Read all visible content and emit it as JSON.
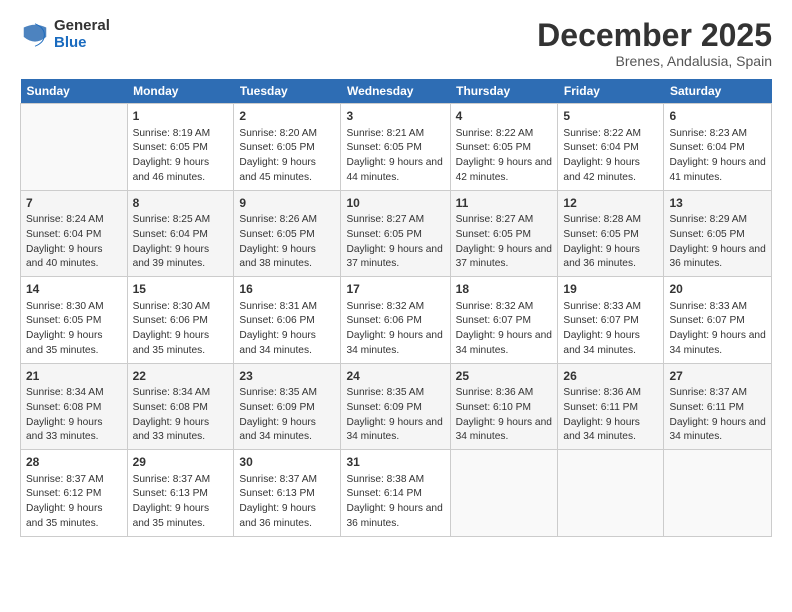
{
  "logo": {
    "general": "General",
    "blue": "Blue"
  },
  "title": "December 2025",
  "location": "Brenes, Andalusia, Spain",
  "headers": [
    "Sunday",
    "Monday",
    "Tuesday",
    "Wednesday",
    "Thursday",
    "Friday",
    "Saturday"
  ],
  "weeks": [
    [
      {
        "day": "",
        "empty": true
      },
      {
        "day": "1",
        "sunrise": "Sunrise: 8:19 AM",
        "sunset": "Sunset: 6:05 PM",
        "daylight": "Daylight: 9 hours and 46 minutes."
      },
      {
        "day": "2",
        "sunrise": "Sunrise: 8:20 AM",
        "sunset": "Sunset: 6:05 PM",
        "daylight": "Daylight: 9 hours and 45 minutes."
      },
      {
        "day": "3",
        "sunrise": "Sunrise: 8:21 AM",
        "sunset": "Sunset: 6:05 PM",
        "daylight": "Daylight: 9 hours and 44 minutes."
      },
      {
        "day": "4",
        "sunrise": "Sunrise: 8:22 AM",
        "sunset": "Sunset: 6:05 PM",
        "daylight": "Daylight: 9 hours and 42 minutes."
      },
      {
        "day": "5",
        "sunrise": "Sunrise: 8:22 AM",
        "sunset": "Sunset: 6:04 PM",
        "daylight": "Daylight: 9 hours and 42 minutes."
      },
      {
        "day": "6",
        "sunrise": "Sunrise: 8:23 AM",
        "sunset": "Sunset: 6:04 PM",
        "daylight": "Daylight: 9 hours and 41 minutes."
      }
    ],
    [
      {
        "day": "7",
        "sunrise": "Sunrise: 8:24 AM",
        "sunset": "Sunset: 6:04 PM",
        "daylight": "Daylight: 9 hours and 40 minutes."
      },
      {
        "day": "8",
        "sunrise": "Sunrise: 8:25 AM",
        "sunset": "Sunset: 6:04 PM",
        "daylight": "Daylight: 9 hours and 39 minutes."
      },
      {
        "day": "9",
        "sunrise": "Sunrise: 8:26 AM",
        "sunset": "Sunset: 6:05 PM",
        "daylight": "Daylight: 9 hours and 38 minutes."
      },
      {
        "day": "10",
        "sunrise": "Sunrise: 8:27 AM",
        "sunset": "Sunset: 6:05 PM",
        "daylight": "Daylight: 9 hours and 37 minutes."
      },
      {
        "day": "11",
        "sunrise": "Sunrise: 8:27 AM",
        "sunset": "Sunset: 6:05 PM",
        "daylight": "Daylight: 9 hours and 37 minutes."
      },
      {
        "day": "12",
        "sunrise": "Sunrise: 8:28 AM",
        "sunset": "Sunset: 6:05 PM",
        "daylight": "Daylight: 9 hours and 36 minutes."
      },
      {
        "day": "13",
        "sunrise": "Sunrise: 8:29 AM",
        "sunset": "Sunset: 6:05 PM",
        "daylight": "Daylight: 9 hours and 36 minutes."
      }
    ],
    [
      {
        "day": "14",
        "sunrise": "Sunrise: 8:30 AM",
        "sunset": "Sunset: 6:05 PM",
        "daylight": "Daylight: 9 hours and 35 minutes."
      },
      {
        "day": "15",
        "sunrise": "Sunrise: 8:30 AM",
        "sunset": "Sunset: 6:06 PM",
        "daylight": "Daylight: 9 hours and 35 minutes."
      },
      {
        "day": "16",
        "sunrise": "Sunrise: 8:31 AM",
        "sunset": "Sunset: 6:06 PM",
        "daylight": "Daylight: 9 hours and 34 minutes."
      },
      {
        "day": "17",
        "sunrise": "Sunrise: 8:32 AM",
        "sunset": "Sunset: 6:06 PM",
        "daylight": "Daylight: 9 hours and 34 minutes."
      },
      {
        "day": "18",
        "sunrise": "Sunrise: 8:32 AM",
        "sunset": "Sunset: 6:07 PM",
        "daylight": "Daylight: 9 hours and 34 minutes."
      },
      {
        "day": "19",
        "sunrise": "Sunrise: 8:33 AM",
        "sunset": "Sunset: 6:07 PM",
        "daylight": "Daylight: 9 hours and 34 minutes."
      },
      {
        "day": "20",
        "sunrise": "Sunrise: 8:33 AM",
        "sunset": "Sunset: 6:07 PM",
        "daylight": "Daylight: 9 hours and 34 minutes."
      }
    ],
    [
      {
        "day": "21",
        "sunrise": "Sunrise: 8:34 AM",
        "sunset": "Sunset: 6:08 PM",
        "daylight": "Daylight: 9 hours and 33 minutes."
      },
      {
        "day": "22",
        "sunrise": "Sunrise: 8:34 AM",
        "sunset": "Sunset: 6:08 PM",
        "daylight": "Daylight: 9 hours and 33 minutes."
      },
      {
        "day": "23",
        "sunrise": "Sunrise: 8:35 AM",
        "sunset": "Sunset: 6:09 PM",
        "daylight": "Daylight: 9 hours and 34 minutes."
      },
      {
        "day": "24",
        "sunrise": "Sunrise: 8:35 AM",
        "sunset": "Sunset: 6:09 PM",
        "daylight": "Daylight: 9 hours and 34 minutes."
      },
      {
        "day": "25",
        "sunrise": "Sunrise: 8:36 AM",
        "sunset": "Sunset: 6:10 PM",
        "daylight": "Daylight: 9 hours and 34 minutes."
      },
      {
        "day": "26",
        "sunrise": "Sunrise: 8:36 AM",
        "sunset": "Sunset: 6:11 PM",
        "daylight": "Daylight: 9 hours and 34 minutes."
      },
      {
        "day": "27",
        "sunrise": "Sunrise: 8:37 AM",
        "sunset": "Sunset: 6:11 PM",
        "daylight": "Daylight: 9 hours and 34 minutes."
      }
    ],
    [
      {
        "day": "28",
        "sunrise": "Sunrise: 8:37 AM",
        "sunset": "Sunset: 6:12 PM",
        "daylight": "Daylight: 9 hours and 35 minutes."
      },
      {
        "day": "29",
        "sunrise": "Sunrise: 8:37 AM",
        "sunset": "Sunset: 6:13 PM",
        "daylight": "Daylight: 9 hours and 35 minutes."
      },
      {
        "day": "30",
        "sunrise": "Sunrise: 8:37 AM",
        "sunset": "Sunset: 6:13 PM",
        "daylight": "Daylight: 9 hours and 36 minutes."
      },
      {
        "day": "31",
        "sunrise": "Sunrise: 8:38 AM",
        "sunset": "Sunset: 6:14 PM",
        "daylight": "Daylight: 9 hours and 36 minutes."
      },
      {
        "day": "",
        "empty": true
      },
      {
        "day": "",
        "empty": true
      },
      {
        "day": "",
        "empty": true
      }
    ]
  ]
}
